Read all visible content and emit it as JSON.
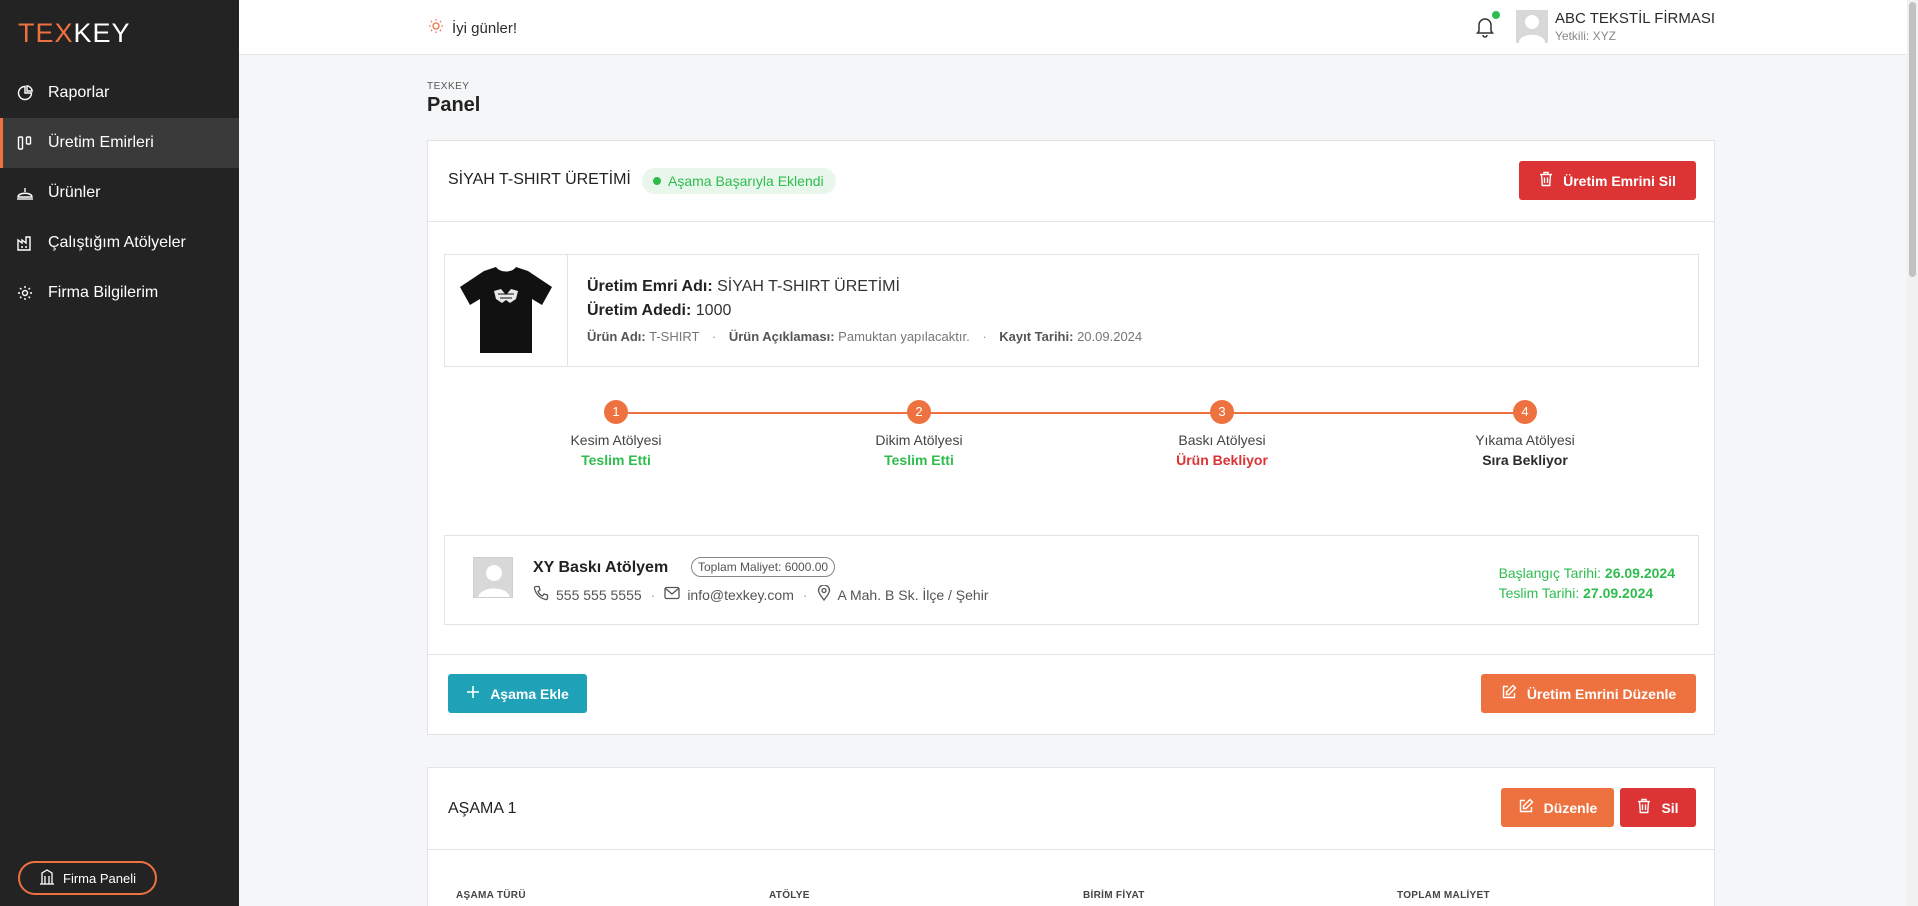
{
  "brand": {
    "logo_part1": "TEX",
    "logo_part2": "KEY"
  },
  "sidebar": {
    "items": [
      {
        "label": "Raporlar",
        "icon": "pie-chart-icon"
      },
      {
        "label": "Üretim Emirleri",
        "icon": "kanban-icon",
        "active": true
      },
      {
        "label": "Ürünler",
        "icon": "cake-icon"
      },
      {
        "label": "Çalıştığım Atölyeler",
        "icon": "factory-icon"
      },
      {
        "label": "Firma Bilgilerim",
        "icon": "gear-icon"
      }
    ],
    "firm_panel_label": "Firma Paneli"
  },
  "topbar": {
    "greeting": "İyi günler!",
    "user_name": "ABC TEKSTİL FİRMASI",
    "user_role": "Yetkili: XYZ"
  },
  "page": {
    "crumb": "TEXKEY",
    "title": "Panel"
  },
  "order": {
    "title": "SİYAH T-SHIRT ÜRETİMİ",
    "badge": "Aşama Başarıyla Eklendi",
    "delete_label": "Üretim Emrini Sil",
    "name_label": "Üretim Emri Adı:",
    "name_value": "SİYAH T-SHIRT ÜRETİMİ",
    "qty_label": "Üretim Adedi:",
    "qty_value": "1000",
    "product_label": "Ürün Adı:",
    "product_value": "T-SHIRT",
    "desc_label": "Ürün Açıklaması:",
    "desc_value": "Pamuktan yapılacaktır.",
    "date_label": "Kayıt Tarihi:",
    "date_value": "20.09.2024",
    "dot": "·",
    "steps": [
      {
        "num": "1",
        "name": "Kesim Atölyesi",
        "status": "Teslim Etti",
        "color": "#2ebd4d"
      },
      {
        "num": "2",
        "name": "Dikim Atölyesi",
        "status": "Teslim Etti",
        "color": "#2ebd4d"
      },
      {
        "num": "3",
        "name": "Baskı Atölyesi",
        "status": "Ürün Bekliyor",
        "color": "#dc3434"
      },
      {
        "num": "4",
        "name": "Yıkama Atölyesi",
        "status": "Sıra Bekliyor",
        "color": "#2b2b2b"
      }
    ],
    "workshop": {
      "name": "XY Baskı Atölyem",
      "cost": "Toplam Maliyet: 6000.00",
      "phone": "555 555 5555",
      "email": "info@texkey.com",
      "address": "A Mah. B Sk. İlçe / Şehir",
      "start_label": "Başlangıç Tarihi:",
      "start_value": "26.09.2024",
      "end_label": "Teslim Tarihi:",
      "end_value": "27.09.2024"
    },
    "add_stage_label": "Aşama Ekle",
    "edit_label": "Üretim Emrini Düzenle"
  },
  "stage": {
    "title": "AŞAMA 1",
    "edit_label": "Düzenle",
    "delete_label": "Sil",
    "columns": [
      "AŞAMA TÜRÜ",
      "ATÖLYE",
      "BİRİM FİYAT",
      "TOPLAM MALİYET"
    ]
  },
  "colors": {
    "accent": "#ee7240",
    "danger": "#dc3434",
    "success": "#2ebd4d",
    "teal": "#1fa1b8",
    "sidebar": "#232323"
  }
}
